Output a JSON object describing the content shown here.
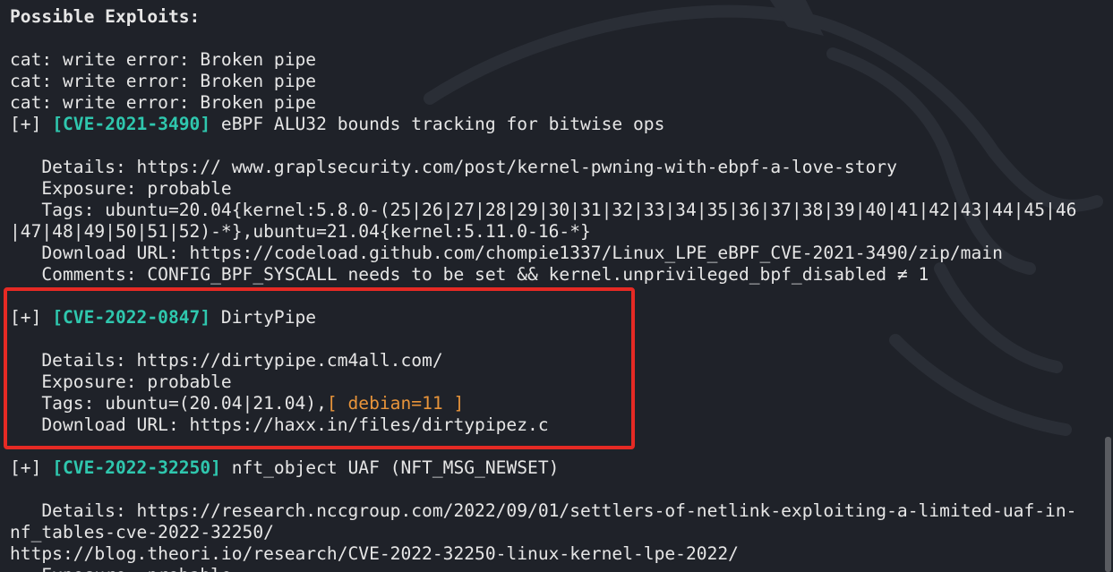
{
  "terminal": {
    "heading": "Possible Exploits:",
    "write_errors": [
      "cat: write error: Broken pipe",
      "cat: write error: Broken pipe",
      "cat: write error: Broken pipe"
    ],
    "exploit1": {
      "prefix": "[+] ",
      "cve": "[CVE-2021-3490]",
      "title": " eBPF ALU32 bounds tracking for bitwise ops",
      "details": "   Details: https:// www.graplsecurity.com/post/kernel-pwning-with-ebpf-a-love-story",
      "exposure": "   Exposure: probable",
      "tags_line1": "   Tags: ubuntu=20.04{kernel:5.8.0-(25|26|27|28|29|30|31|32|33|34|35|36|37|38|39|40|41|42|43|44|45|46",
      "tags_line2": "|47|48|49|50|51|52)-*},ubuntu=21.04{kernel:5.11.0-16-*}",
      "download": "   Download URL: https://codeload.github.com/chompie1337/Linux_LPE_eBPF_CVE-2021-3490/zip/main",
      "comments": "   Comments: CONFIG_BPF_SYSCALL needs to be set && kernel.unprivileged_bpf_disabled ≠ 1"
    },
    "exploit2": {
      "prefix": "[+] ",
      "cve": "[CVE-2022-0847]",
      "title": " DirtyPipe",
      "details": "   Details: https://dirtypipe.cm4all.com/",
      "exposure": "   Exposure: probable",
      "tags_prefix": "   Tags: ubuntu=(20.04|21.04),",
      "tags_highlight": "[ debian=11 ]",
      "download": "   Download URL: https://haxx.in/files/dirtypipez.c"
    },
    "exploit3": {
      "prefix": "[+] ",
      "cve": "[CVE-2022-32250]",
      "title": " nft_object UAF (NFT_MSG_NEWSET)",
      "details_line1": "   Details: https://research.nccgroup.com/2022/09/01/settlers-of-netlink-exploiting-a-limited-uaf-in-",
      "details_line2": "nf_tables-cve-2022-32250/",
      "details_line3": "https://blog.theori.io/research/CVE-2022-32250-linux-kernel-lpe-2022/",
      "exposure_partial": "   Exposure: probable"
    }
  },
  "colors": {
    "background": "#1f2229",
    "text": "#e6e6e6",
    "cve_accent": "#2fc7ae",
    "tag_highlight": "#e8943a",
    "annotation_box": "#e62a24"
  },
  "icons": {
    "background_watermark": "kali-dragon-icon"
  }
}
